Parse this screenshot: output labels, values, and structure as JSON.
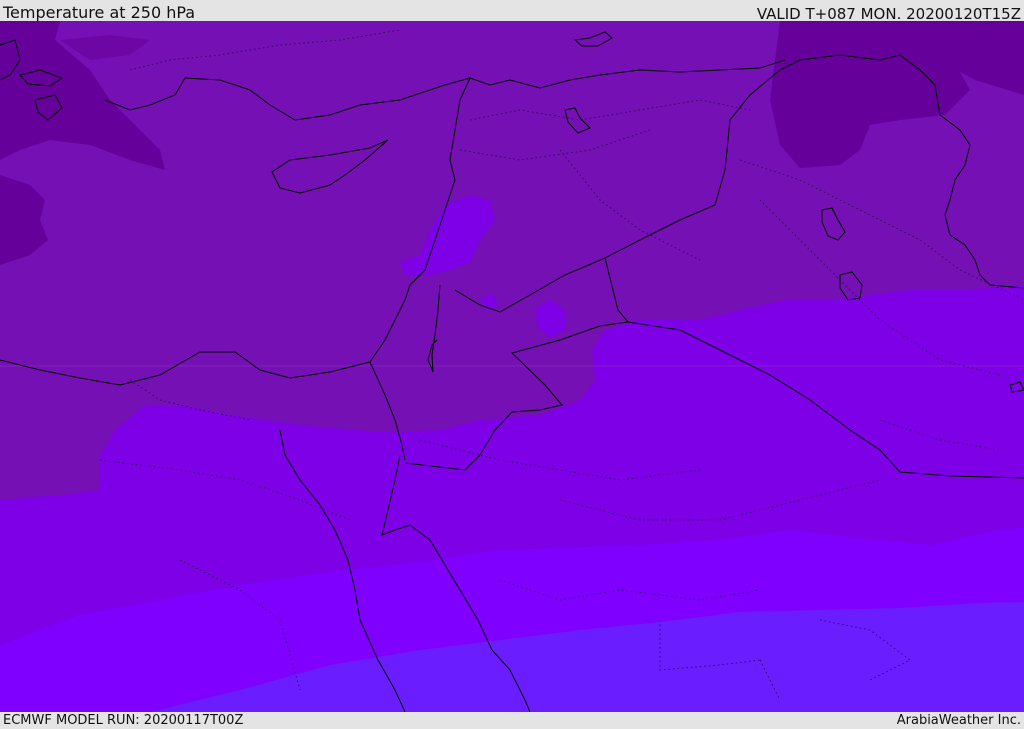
{
  "header": {
    "title": "Temperature at 250 hPa",
    "valid_time": "VALID T+087 MON. 20200120T15Z"
  },
  "footer": {
    "model_run": "ECMWF MODEL RUN: 20200117T00Z",
    "credit": "ArabiaWeather Inc."
  },
  "colors": {
    "band_1_darkest": "#65009a",
    "band_2": "#7510b4",
    "band_3": "#7e00e6",
    "band_4": "#7f00ff",
    "band_5_lightest": "#6a1dff",
    "coastline": "#000000",
    "frame": "#e4e4e4"
  }
}
